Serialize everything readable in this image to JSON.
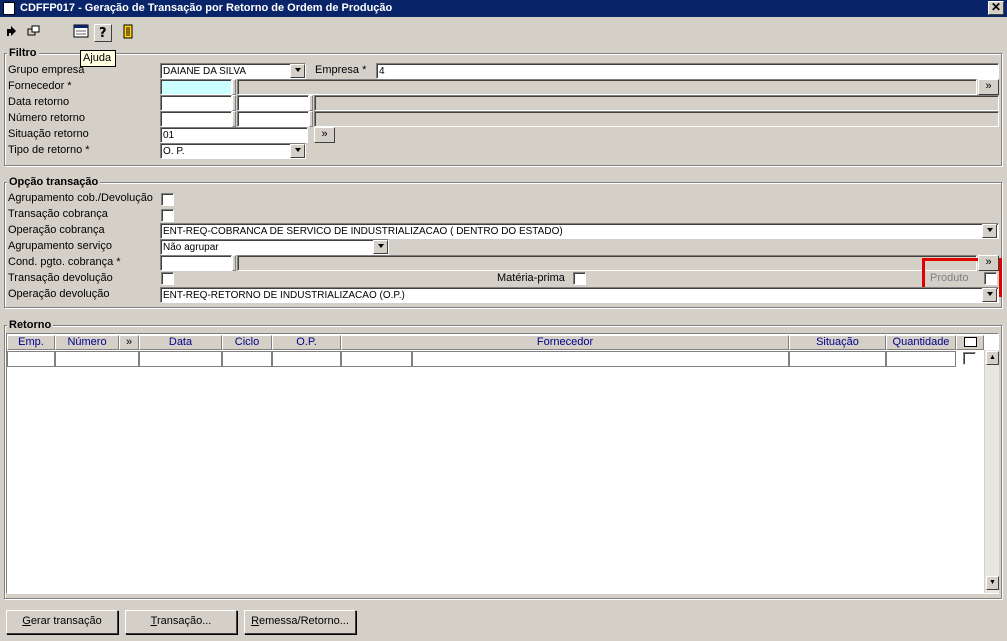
{
  "window": {
    "title": "CDFFP017 - Geração de Transação por Retorno de Ordem de Produção",
    "close_glyph": "✕"
  },
  "toolbar": {
    "icons": [
      "back-arrow-icon",
      "windows-icon",
      "calendar-icon",
      "help-icon",
      "exit-door-icon"
    ],
    "tooltip": "Ajuda"
  },
  "filtro": {
    "legend": "Filtro",
    "grupo_empresa": {
      "label": "Grupo empresa",
      "value": "DAIANE DA SILVA"
    },
    "empresa": {
      "label": "Empresa *",
      "value": "4"
    },
    "fornecedor": {
      "label": "Fornecedor *",
      "value": ""
    },
    "data_retorno": {
      "label": "Data retorno"
    },
    "numero_retorno": {
      "label": "Número retorno"
    },
    "situacao_retorno": {
      "label": "Situação retorno",
      "value": "01"
    },
    "tipo_retorno": {
      "label": "Tipo de retorno *",
      "value": "O. P."
    },
    "more_glyph": "»"
  },
  "opcao": {
    "legend": "Opção transação",
    "agrupamento_cob": {
      "label": "Agrupamento cob./Devolução",
      "checked": false
    },
    "transacao_cobranca": {
      "label": "Transação cobrança"
    },
    "operacao_cobranca": {
      "label": "Operação cobrança",
      "value": "ENT-REQ-COBRANCA DE SERVICO DE INDUSTRIALIZACAO ( DENTRO DO ESTADO)"
    },
    "agrupamento_servico": {
      "label": "Agrupamento serviço",
      "value": "Não agrupar"
    },
    "cond_pgto": {
      "label": "Cond. pgto. cobrança *"
    },
    "transacao_devolucao": {
      "label": "Transação devolução"
    },
    "materia_prima": {
      "label": "Matéria-prima",
      "checked": false
    },
    "produto": {
      "label": "Produto",
      "checked": false
    },
    "operacao_devolucao": {
      "label": "Operação devolução",
      "value": "ENT-REQ-RETORNO DE INDUSTRIALIZACAO (O.P.)"
    },
    "more_glyph": "»"
  },
  "retorno": {
    "legend": "Retorno",
    "columns": [
      "Emp.",
      "Número",
      "»",
      "Data",
      "Ciclo",
      "O.P.",
      "Fornecedor",
      "Situação",
      "Quantidade"
    ]
  },
  "buttons": {
    "gerar": {
      "u": "G",
      "rest": "erar transação"
    },
    "transacao": {
      "u": "T",
      "rest": "ransação..."
    },
    "remessa": {
      "u": "R",
      "rest": "emessa/Retorno..."
    }
  }
}
